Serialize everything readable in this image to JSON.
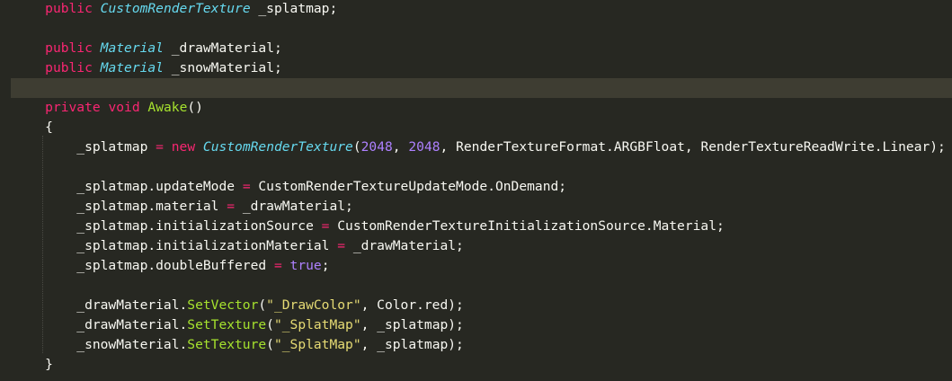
{
  "editor": {
    "lines": [
      {
        "tokens": [
          {
            "t": "    ",
            "c": "pl"
          },
          {
            "t": "public",
            "c": "kw"
          },
          {
            "t": " ",
            "c": "pl"
          },
          {
            "t": "CustomRenderTexture",
            "c": "ty"
          },
          {
            "t": " _splatmap;",
            "c": "pl"
          }
        ]
      },
      {
        "tokens": []
      },
      {
        "tokens": [
          {
            "t": "    ",
            "c": "pl"
          },
          {
            "t": "public",
            "c": "kw"
          },
          {
            "t": " ",
            "c": "pl"
          },
          {
            "t": "Material",
            "c": "ty"
          },
          {
            "t": " _drawMaterial;",
            "c": "pl"
          }
        ]
      },
      {
        "tokens": [
          {
            "t": "    ",
            "c": "pl"
          },
          {
            "t": "public",
            "c": "kw"
          },
          {
            "t": " ",
            "c": "pl"
          },
          {
            "t": "Material",
            "c": "ty"
          },
          {
            "t": " _snowMaterial;",
            "c": "pl"
          }
        ]
      },
      {
        "tokens": [],
        "current": true
      },
      {
        "tokens": [
          {
            "t": "    ",
            "c": "pl"
          },
          {
            "t": "private",
            "c": "kw"
          },
          {
            "t": " ",
            "c": "pl"
          },
          {
            "t": "void",
            "c": "kw"
          },
          {
            "t": " ",
            "c": "pl"
          },
          {
            "t": "Awake",
            "c": "fn"
          },
          {
            "t": "()",
            "c": "pl"
          }
        ]
      },
      {
        "tokens": [
          {
            "t": "    {",
            "c": "pl"
          }
        ]
      },
      {
        "tokens": [
          {
            "t": "        _splatmap ",
            "c": "pl"
          },
          {
            "t": "=",
            "c": "kw"
          },
          {
            "t": " ",
            "c": "pl"
          },
          {
            "t": "new",
            "c": "kw"
          },
          {
            "t": " ",
            "c": "pl"
          },
          {
            "t": "CustomRenderTexture",
            "c": "ty"
          },
          {
            "t": "(",
            "c": "pl"
          },
          {
            "t": "2048",
            "c": "num"
          },
          {
            "t": ", ",
            "c": "pl"
          },
          {
            "t": "2048",
            "c": "num"
          },
          {
            "t": ", RenderTextureFormat.ARGBFloat, RenderTextureReadWrite.Linear);",
            "c": "pl"
          }
        ]
      },
      {
        "tokens": []
      },
      {
        "tokens": [
          {
            "t": "        _splatmap.updateMode ",
            "c": "pl"
          },
          {
            "t": "=",
            "c": "kw"
          },
          {
            "t": " CustomRenderTextureUpdateMode.OnDemand;",
            "c": "pl"
          }
        ]
      },
      {
        "tokens": [
          {
            "t": "        _splatmap.material ",
            "c": "pl"
          },
          {
            "t": "=",
            "c": "kw"
          },
          {
            "t": " _drawMaterial;",
            "c": "pl"
          }
        ]
      },
      {
        "tokens": [
          {
            "t": "        _splatmap.initializationSource ",
            "c": "pl"
          },
          {
            "t": "=",
            "c": "kw"
          },
          {
            "t": " CustomRenderTextureInitializationSource.Material;",
            "c": "pl"
          }
        ]
      },
      {
        "tokens": [
          {
            "t": "        _splatmap.initializationMaterial ",
            "c": "pl"
          },
          {
            "t": "=",
            "c": "kw"
          },
          {
            "t": " _drawMaterial;",
            "c": "pl"
          }
        ]
      },
      {
        "tokens": [
          {
            "t": "        _splatmap.doubleBuffered ",
            "c": "pl"
          },
          {
            "t": "=",
            "c": "kw"
          },
          {
            "t": " ",
            "c": "pl"
          },
          {
            "t": "true",
            "c": "num"
          },
          {
            "t": ";",
            "c": "pl"
          }
        ]
      },
      {
        "tokens": []
      },
      {
        "tokens": [
          {
            "t": "        _drawMaterial.",
            "c": "pl"
          },
          {
            "t": "SetVector",
            "c": "fn"
          },
          {
            "t": "(",
            "c": "pl"
          },
          {
            "t": "\"_DrawColor\"",
            "c": "str"
          },
          {
            "t": ", Color.red);",
            "c": "pl"
          }
        ]
      },
      {
        "tokens": [
          {
            "t": "        _drawMaterial.",
            "c": "pl"
          },
          {
            "t": "SetTexture",
            "c": "fn"
          },
          {
            "t": "(",
            "c": "pl"
          },
          {
            "t": "\"_SplatMap\"",
            "c": "str"
          },
          {
            "t": ", _splatmap);",
            "c": "pl"
          }
        ]
      },
      {
        "tokens": [
          {
            "t": "        _snowMaterial.",
            "c": "pl"
          },
          {
            "t": "SetTexture",
            "c": "fn"
          },
          {
            "t": "(",
            "c": "pl"
          },
          {
            "t": "\"_SplatMap\"",
            "c": "str"
          },
          {
            "t": ", _splatmap);",
            "c": "pl"
          }
        ]
      },
      {
        "tokens": [
          {
            "t": "    }",
            "c": "pl"
          }
        ]
      }
    ]
  }
}
